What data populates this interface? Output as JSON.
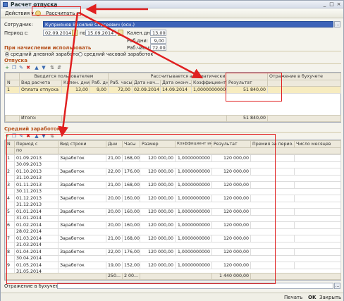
{
  "window": {
    "title": "Расчет отпуска"
  },
  "toolbar": {
    "actions": "Действия",
    "calculate": "Рассчитать",
    "arrow": "▾"
  },
  "form": {
    "employee_label": "Сотрудник:",
    "employee_value": "Куприянов Василий Сергеевич (осн.)",
    "period_label": "Период с:",
    "period_from": "02.09.2014",
    "period_to_label": "по:",
    "period_to": "15.09.2014",
    "cal_days_label": "Кален.дни:",
    "cal_days": "13,00",
    "work_days_label": "Раб.дни:",
    "work_days": "9,00",
    "work_hours_label": "Раб.часы:",
    "work_hours": "72,00"
  },
  "avg_section": {
    "title": "При начислении использовать",
    "opt1": "средний дневной заработок",
    "opt2": "средний часовой заработок"
  },
  "vacation": {
    "title": "Отпуска",
    "group_headers": [
      "Вводится пользователем",
      "Рассчитывается автоматически",
      "Отражение в бухучете"
    ],
    "headers": [
      "N",
      "Вид расчета",
      "Кален. дни",
      "Раб. дни",
      "Раб. часы",
      "Дата нач...",
      "Дата оконч...",
      "Коэффициент",
      "Результат",
      ""
    ],
    "rows": [
      [
        "1",
        "Оплата отпуска",
        "13,00",
        "9,00",
        "72,00",
        "02.09.2014",
        "14.09.2014",
        "1,0000000000",
        "51 840,00",
        ""
      ]
    ],
    "footer_label": "Итого:",
    "footer_total": "51 840,00"
  },
  "earnings": {
    "title": "Средний заработок",
    "headers": [
      "N",
      "Период с",
      "Вид строки",
      "Дни",
      "Часы",
      "Размер",
      "Коэффициент индексации",
      "Результат",
      "Премия за перио...",
      "Число месяцев"
    ],
    "sub_header": "по",
    "rows": [
      [
        "1",
        "01.09.2013",
        "30.09.2013",
        "Заработок",
        "21,00",
        "168,00",
        "120 000,00",
        "1,0000000000",
        "120 000,00"
      ],
      [
        "2",
        "01.10.2013",
        "31.10.2013",
        "Заработок",
        "22,00",
        "176,00",
        "120 000,00",
        "1,0000000000",
        "120 000,00"
      ],
      [
        "3",
        "01.11.2013",
        "30.11.2013",
        "Заработок",
        "21,00",
        "168,00",
        "120 000,00",
        "1,0000000000",
        "120 000,00"
      ],
      [
        "4",
        "01.12.2013",
        "31.12.2013",
        "Заработок",
        "20,00",
        "160,00",
        "120 000,00",
        "1,0000000000",
        "120 000,00"
      ],
      [
        "5",
        "01.01.2014",
        "31.01.2014",
        "Заработок",
        "20,00",
        "160,00",
        "120 000,00",
        "1,0000000000",
        "120 000,00"
      ],
      [
        "6",
        "01.02.2014",
        "28.02.2014",
        "Заработок",
        "20,00",
        "160,00",
        "120 000,00",
        "1,0000000000",
        "120 000,00"
      ],
      [
        "7",
        "01.03.2014",
        "31.03.2014",
        "Заработок",
        "21,00",
        "168,00",
        "120 000,00",
        "1,0000000000",
        "120 000,00"
      ],
      [
        "8",
        "01.04.2014",
        "30.04.2014",
        "Заработок",
        "22,00",
        "176,00",
        "120 000,00",
        "1,0000000000",
        "120 000,00"
      ],
      [
        "9",
        "01.05.2014",
        "31.05.2014",
        "Заработок",
        "19,00",
        "152,00",
        "120 000,00",
        "1,0000000000",
        "120 000,00"
      ]
    ],
    "footer": [
      "250...",
      "2 00...",
      "1 440 000,00"
    ]
  },
  "accounting": {
    "label": "Отражение в бухучете:"
  },
  "status": {
    "print": "Печать",
    "ok": "OK",
    "close": "Закрыть"
  }
}
